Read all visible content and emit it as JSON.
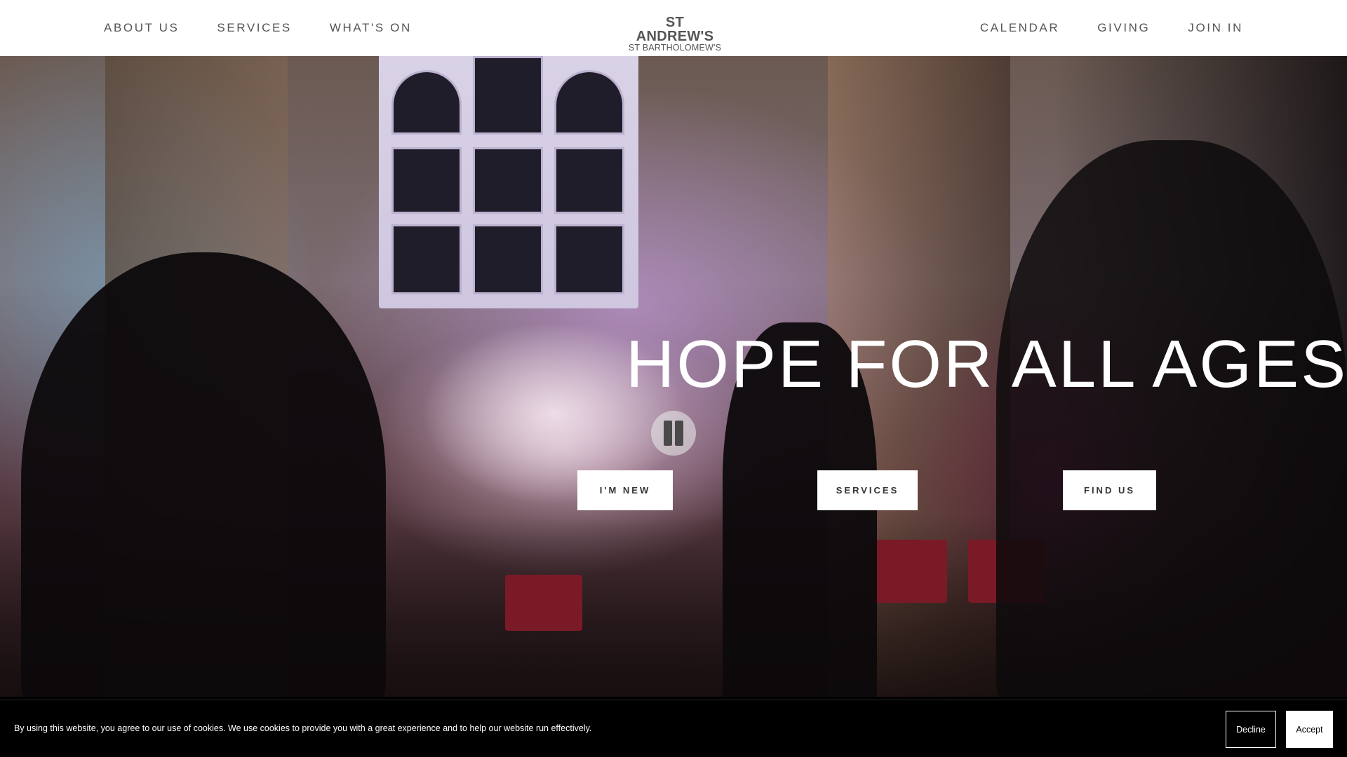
{
  "header": {
    "nav_left": [
      "ABOUT US",
      "SERVICES",
      "WHAT'S ON"
    ],
    "nav_right": [
      "CALENDAR",
      "GIVING",
      "JOIN IN"
    ],
    "logo_main": "ST ANDREW'S",
    "logo_sub": "ST BARTHOLOMEW'S"
  },
  "hero": {
    "headline": "HOPE FOR ALL AGES",
    "buttons": {
      "new": "I'M NEW",
      "services": "SERVICES",
      "find": "FIND US"
    },
    "video_state": "playing"
  },
  "cookie": {
    "text": "By using this website, you agree to our use of cookies. We use cookies to provide you with a great experience and to help our website run effectively.",
    "decline": "Decline",
    "accept": "Accept"
  },
  "icons": {
    "pause": "pause-icon"
  },
  "colors": {
    "header_bg": "#ffffff",
    "nav_text": "#555555",
    "cookie_bg": "#000000",
    "cta_bg": "#ffffff"
  }
}
